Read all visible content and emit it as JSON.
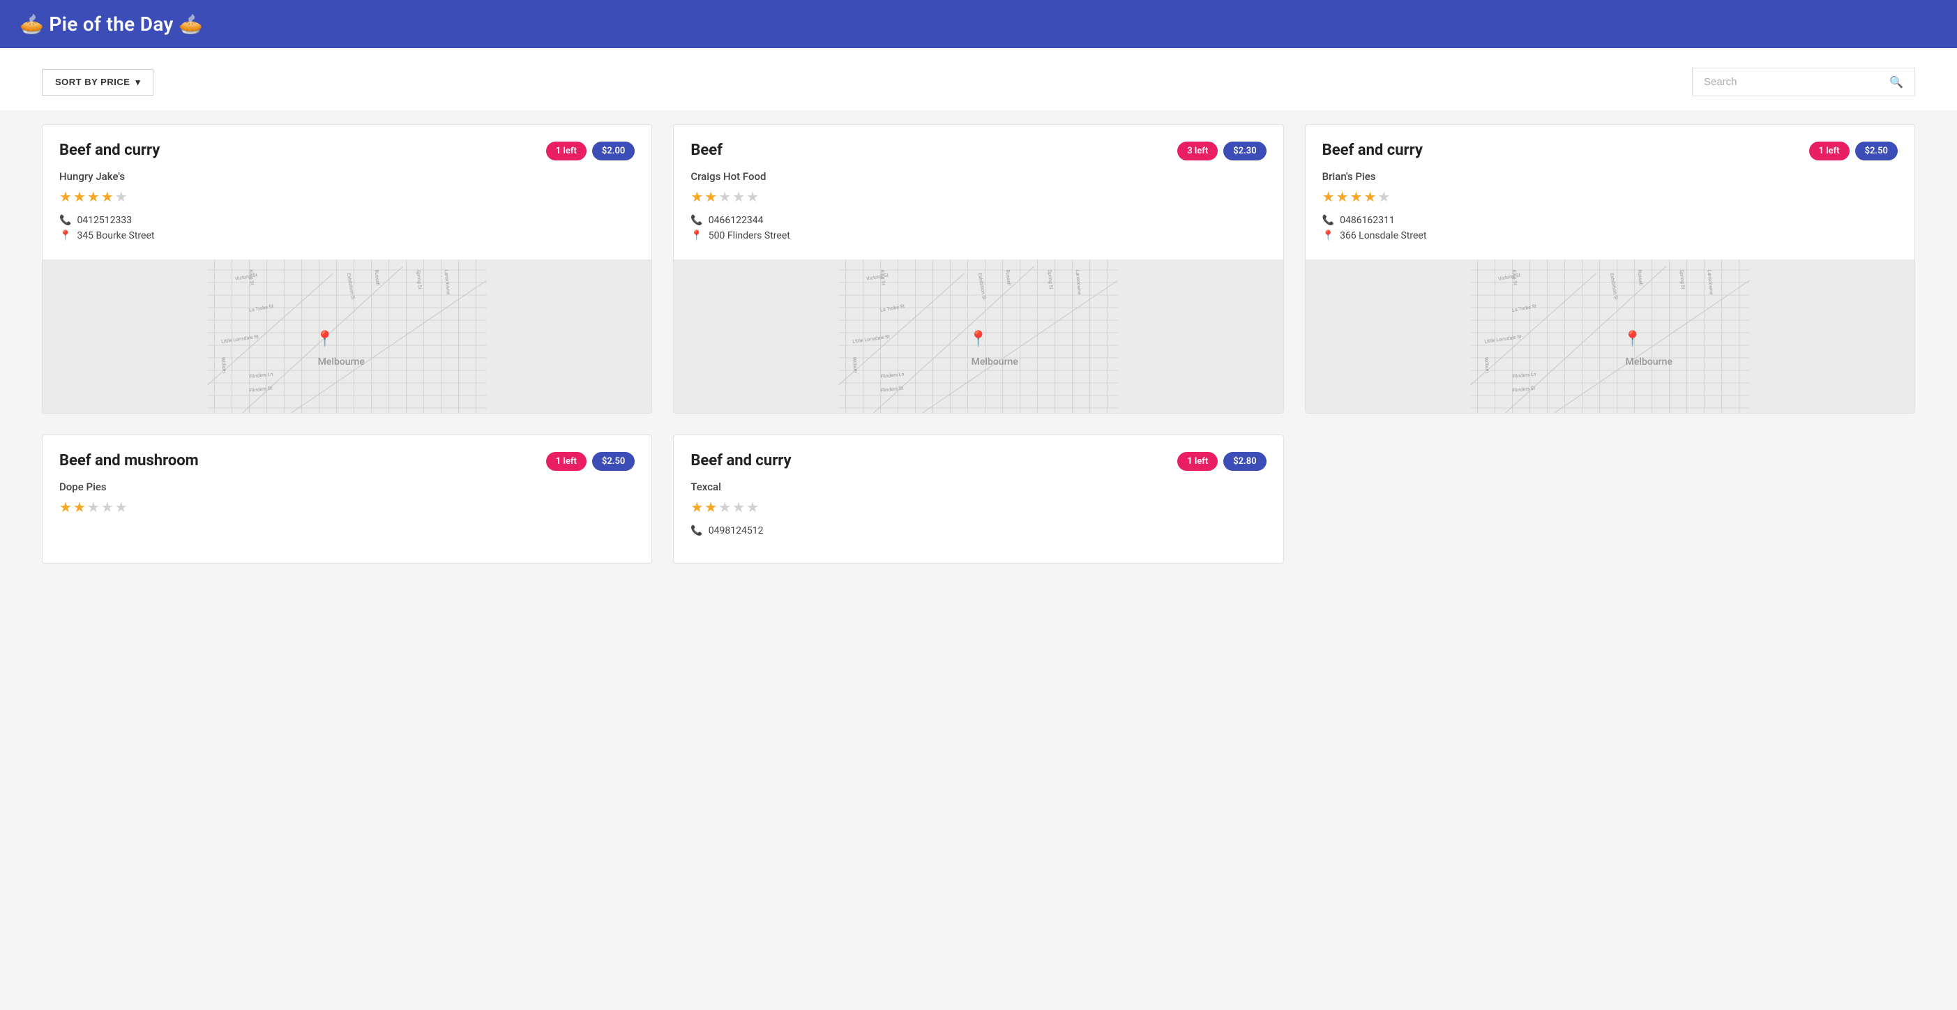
{
  "app": {
    "title": "🥧 Pie of the Day 🥧"
  },
  "toolbar": {
    "sort_label": "SORT BY PRICE",
    "sort_arrow": "▾",
    "search_placeholder": "Search"
  },
  "cards": [
    {
      "id": 1,
      "title": "Beef and curry",
      "left_count": "1 left",
      "price": "$2.00",
      "vendor": "Hungry Jake's",
      "stars": 4,
      "phone": "0412512333",
      "address": "345 Bourke Street",
      "map_center": [
        0.42,
        0.55
      ]
    },
    {
      "id": 2,
      "title": "Beef",
      "left_count": "3 left",
      "price": "$2.30",
      "vendor": "Craigs Hot Food",
      "stars": 2,
      "phone": "0466122344",
      "address": "500 Flinders Street",
      "map_center": [
        0.5,
        0.55
      ]
    },
    {
      "id": 3,
      "title": "Beef and curry",
      "left_count": "1 left",
      "price": "$2.50",
      "vendor": "Brian's Pies",
      "stars": 4,
      "phone": "0486162311",
      "address": "366 Lonsdale Street",
      "map_center": [
        0.58,
        0.55
      ]
    },
    {
      "id": 4,
      "title": "Beef and mushroom",
      "left_count": "1 left",
      "price": "$2.50",
      "vendor": "Dope Pies",
      "stars": 2,
      "phone": "",
      "address": "",
      "map_center": [
        0.42,
        0.55
      ]
    },
    {
      "id": 5,
      "title": "Beef and curry",
      "left_count": "1 left",
      "price": "$2.80",
      "vendor": "Texcal",
      "stars": 2,
      "phone": "0498124512",
      "address": "",
      "map_center": [
        0.5,
        0.55
      ]
    }
  ]
}
